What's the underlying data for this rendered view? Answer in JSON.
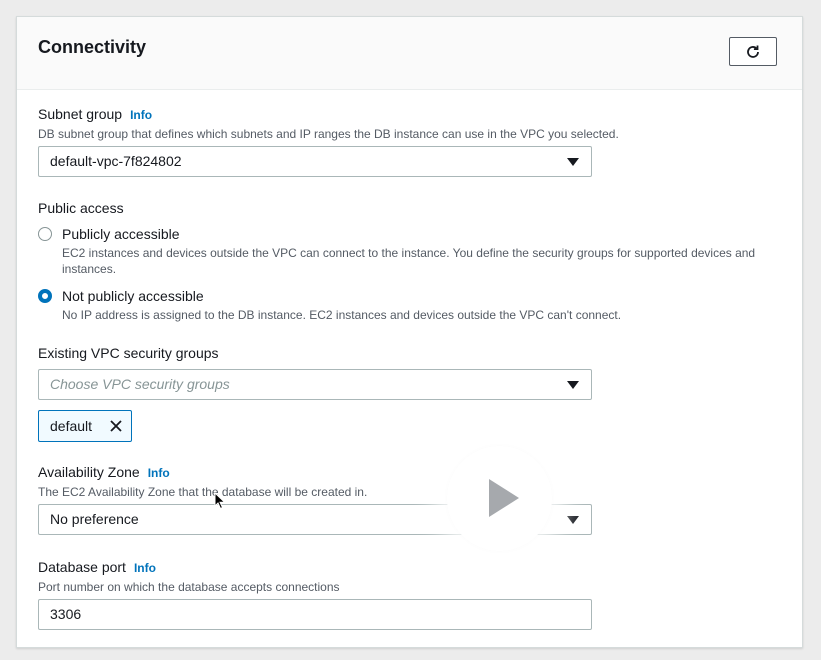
{
  "panel": {
    "title": "Connectivity",
    "refresh_icon": "refresh-icon"
  },
  "subnet_group": {
    "label": "Subnet group",
    "info": "Info",
    "description": "DB subnet group that defines which subnets and IP ranges the DB instance can use in the VPC you selected.",
    "value": "default-vpc-7f824802"
  },
  "public_access": {
    "label": "Public access",
    "options": [
      {
        "label": "Publicly accessible",
        "description": "EC2 instances and devices outside the VPC can connect to the instance. You define the security groups for supported devices and instances.",
        "selected": false
      },
      {
        "label": "Not publicly accessible",
        "description": "No IP address is assigned to the DB instance. EC2 instances and devices outside the VPC can't connect.",
        "selected": true
      }
    ]
  },
  "security_groups": {
    "label": "Existing VPC security groups",
    "placeholder": "Choose VPC security groups",
    "tokens": [
      "default"
    ]
  },
  "availability_zone": {
    "label": "Availability Zone",
    "info": "Info",
    "description": "The EC2 Availability Zone that the database will be created in.",
    "value": "No preference"
  },
  "database_port": {
    "label": "Database port",
    "info": "Info",
    "description": "Port number on which the database accepts connections",
    "value": "3306"
  },
  "colors": {
    "link": "#0073bb",
    "text": "#16191f",
    "secondary": "#545b64"
  }
}
